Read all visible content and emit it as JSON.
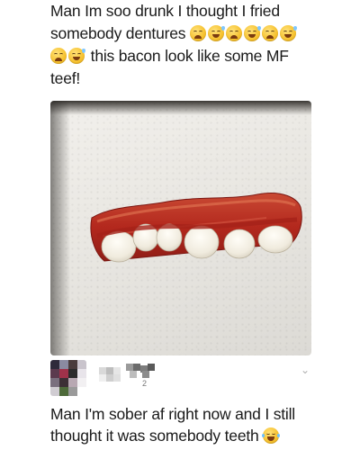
{
  "post": {
    "line1": "Man Im soo drunk I thought I fried",
    "line2_text": "somebody dentures",
    "line3_text": "this bacon look like some MF",
    "line4": "teef!",
    "line2_emojis": [
      "weary-face-icon",
      "grinning-sweat-icon",
      "weary-face-icon",
      "grinning-sweat-icon",
      "weary-face-icon",
      "grinning-sweat-icon"
    ],
    "line3_emojis": [
      "weary-face-icon",
      "grinning-sweat-icon"
    ]
  },
  "photo": {
    "subject": "bacon-dentures-photo"
  },
  "reply": {
    "count": "2",
    "text_line1": "Man I'm sober af right now and I still",
    "text_line2": "thought it was somebody teeth",
    "emoji": "tears-of-joy-icon"
  },
  "colors": {
    "text": "#1a1a1a",
    "emoji_yellow": "#f6c12e",
    "bacon_red": "#b8281e",
    "tooth": "#f3efe6"
  }
}
